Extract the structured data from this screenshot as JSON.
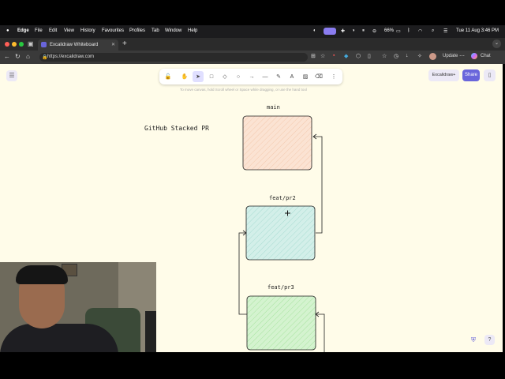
{
  "menubar": {
    "app": "Edge",
    "items": [
      "File",
      "Edit",
      "View",
      "History",
      "Favourites",
      "Profiles",
      "Tab",
      "Window",
      "Help"
    ],
    "battery": "66%",
    "datetime": "Tue 11 Aug  3:46 PM"
  },
  "tabs": [
    {
      "title": "Excalidraw Whiteboard"
    }
  ],
  "address": {
    "url": "https://excalidraw.com",
    "update_label": "Update",
    "chat_label": "Chat"
  },
  "excalidraw": {
    "hint": "To move canvas, hold Scroll wheel or Space while dragging, or use the hand tool",
    "plus_label": "Excalidraw+",
    "share_label": "Share",
    "title_text": "GitHub Stacked PR",
    "boxes": [
      {
        "label": "main",
        "fill": "#fbe3d3"
      },
      {
        "label": "feat/pr2",
        "fill": "#d3efe9"
      },
      {
        "label": "feat/pr3",
        "fill": "#d4f3cf"
      }
    ]
  },
  "colors": {
    "accent": "#6965db",
    "canvas": "#fffce9"
  }
}
